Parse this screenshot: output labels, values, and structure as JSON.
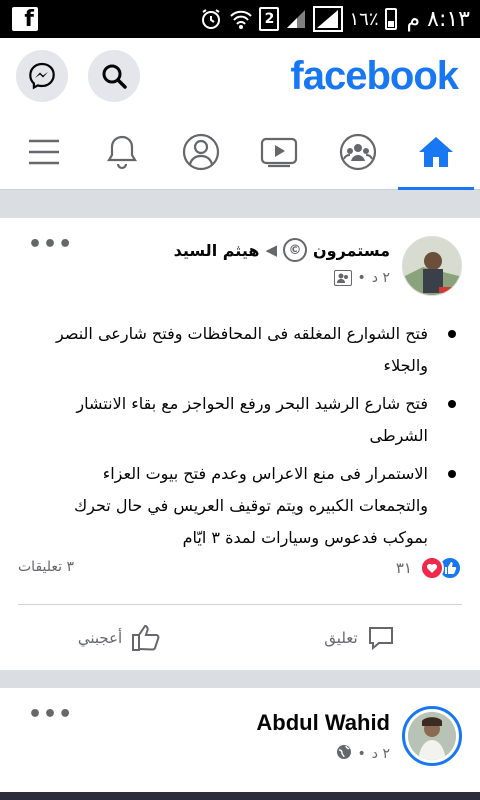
{
  "status_bar": {
    "left_app": "f",
    "sim_label": "2",
    "battery": "١٦٪",
    "time": "٨:١٣ م"
  },
  "header": {
    "brand": "facebook"
  },
  "tabs": [
    {
      "name": "menu",
      "icon": "hamburger-icon"
    },
    {
      "name": "notifications",
      "icon": "bell-icon"
    },
    {
      "name": "profile",
      "icon": "profile-icon"
    },
    {
      "name": "watch",
      "icon": "video-icon"
    },
    {
      "name": "groups",
      "icon": "groups-icon"
    },
    {
      "name": "home",
      "icon": "home-icon",
      "active": true
    }
  ],
  "post1": {
    "page_name": "مستمرون",
    "author": "هيثم السيد",
    "time": "٢ د",
    "bullets": [
      "فتح الشوارع المغلقه فى المحافظات وفتح شارعى النصر والجلاء",
      "فتح شارع الرشيد  البحر ورفع الحواجز مع بقاء الانتشار الشرطى",
      "الاستمرار فى منع الاعراس وعدم فتح بيوت العزاء والتجمعات الكبيره ويتم توقيف العريس في حال تحرك بموكب فدعوس وسيارات لمدة ٣ ايّام"
    ],
    "reaction_count": "٣١",
    "comment_count": "٣ تعليقات",
    "like_label": "أعجبني",
    "comment_label": "تعليق"
  },
  "post2": {
    "author": "Abdul Wahid",
    "time": "٢ د"
  },
  "colors": {
    "brand": "#1877f2",
    "love": "#f02849",
    "muted": "#65676b"
  }
}
